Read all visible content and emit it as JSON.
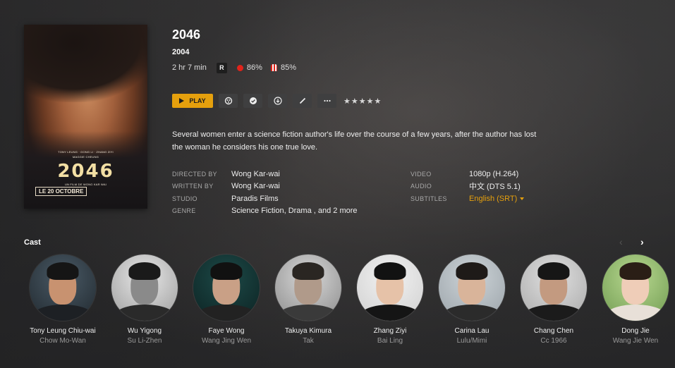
{
  "movie": {
    "title": "2046",
    "year": "2004",
    "runtime": "2 hr 7 min",
    "content_rating": "R",
    "critic_score": "86%",
    "audience_score": "85%",
    "summary": "Several women enter a science fiction author's life over the course of a few years, after the author has lost the woman he considers his one true love.",
    "stars": "★★★★★"
  },
  "poster": {
    "cast_line": "TONY LEUNG · GONG LI · ZHANG ZIYI",
    "sub_line": "MAGGIE CHEUNG",
    "title": "2046",
    "director_line": "UN FILM DE WONG KAR WAI",
    "release": "LE 20 OCTOBRE"
  },
  "actions": {
    "play_label": "PLAY",
    "icons": [
      "trailer-icon",
      "check-icon",
      "download-icon",
      "edit-icon",
      "more-icon"
    ]
  },
  "details": {
    "directed_label": "DIRECTED BY",
    "directed_value": "Wong Kar-wai",
    "written_label": "WRITTEN BY",
    "written_value": "Wong Kar-wai",
    "studio_label": "STUDIO",
    "studio_value": "Paradis Films",
    "genre_label": "GENRE",
    "genre_value": "Science Fiction, Drama , and 2 more"
  },
  "tech": {
    "video_label": "VIDEO",
    "video_value": "1080p (H.264)",
    "audio_label": "AUDIO",
    "audio_value": "中文 (DTS 5.1)",
    "subtitles_label": "SUBTITLES",
    "subtitles_value": "English (SRT)"
  },
  "cast_section": {
    "title": "Cast",
    "prev": "‹",
    "next": "›"
  },
  "cast": [
    {
      "name": "Tony Leung Chiu-wai",
      "role": "Chow Mo-Wan"
    },
    {
      "name": "Wu Yigong",
      "role": "Su Li-Zhen"
    },
    {
      "name": "Faye Wong",
      "role": "Wang Jing Wen"
    },
    {
      "name": "Takuya Kimura",
      "role": "Tak"
    },
    {
      "name": "Zhang Ziyi",
      "role": "Bai Ling"
    },
    {
      "name": "Carina Lau",
      "role": "Lulu/Mimi"
    },
    {
      "name": "Chang Chen",
      "role": "Cc 1966"
    },
    {
      "name": "Dong Jie",
      "role": "Wang Jie Wen"
    }
  ],
  "colors": {
    "accent": "#e5a00d",
    "background": "#2e2e2f"
  }
}
